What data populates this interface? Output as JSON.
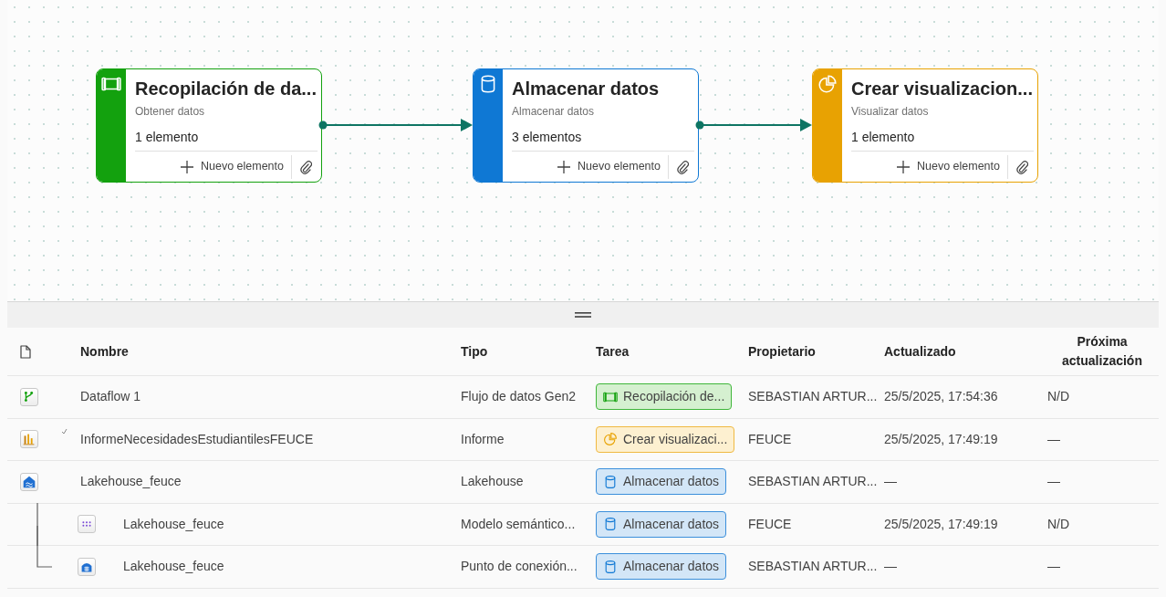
{
  "canvas": {
    "nodes": [
      {
        "kind": "collect",
        "color": "#13a10e",
        "title": "Recopilación de da...",
        "subtitle": "Obtener datos",
        "count": "1 elemento",
        "new_label": "Nuevo elemento"
      },
      {
        "kind": "store",
        "color": "#0f78d4",
        "title": "Almacenar datos",
        "subtitle": "Almacenar datos",
        "count": "3 elementos",
        "new_label": "Nuevo elemento"
      },
      {
        "kind": "visualize",
        "color": "#e8a202",
        "title": "Crear visualizacion...",
        "subtitle": "Visualizar datos",
        "count": "1 elemento",
        "new_label": "Nuevo elemento"
      }
    ]
  },
  "table": {
    "columns": [
      "Nombre",
      "Tipo",
      "Tarea",
      "Propietario",
      "Actualizado",
      "Próxima actualización"
    ],
    "rows": [
      {
        "kind": "dataflow",
        "name": "Dataflow 1",
        "type": "Flujo de datos Gen2",
        "task": {
          "kind": "collect",
          "label": "Recopilación de..."
        },
        "owner": "SEBASTIAN ARTUR...",
        "updated": "25/5/2025, 17:54:36",
        "next": "N/D"
      },
      {
        "kind": "report",
        "name": "InformeNecesidadesEstudiantilesFEUCE",
        "type": "Informe",
        "task": {
          "kind": "visualize",
          "label": "Crear visualizaci..."
        },
        "owner": "FEUCE",
        "updated": "25/5/2025, 17:49:19",
        "next": "—",
        "synced": true
      },
      {
        "kind": "lakehouse",
        "name": "Lakehouse_feuce",
        "type": "Lakehouse",
        "task": {
          "kind": "store",
          "label": "Almacenar datos"
        },
        "owner": "SEBASTIAN ARTUR...",
        "updated": "—",
        "next": "—",
        "children": [
          {
            "kind": "semantic_model",
            "name": "Lakehouse_feuce",
            "type": "Modelo semántico...",
            "task": {
              "kind": "store",
              "label": "Almacenar datos"
            },
            "owner": "FEUCE",
            "updated": "25/5/2025, 17:49:19",
            "next": "N/D"
          },
          {
            "kind": "sql_endpoint",
            "name": "Lakehouse_feuce",
            "type": "Punto de conexión...",
            "task": {
              "kind": "store",
              "label": "Almacenar datos"
            },
            "owner": "SEBASTIAN ARTUR...",
            "updated": "—",
            "next": "—"
          }
        ]
      }
    ]
  }
}
